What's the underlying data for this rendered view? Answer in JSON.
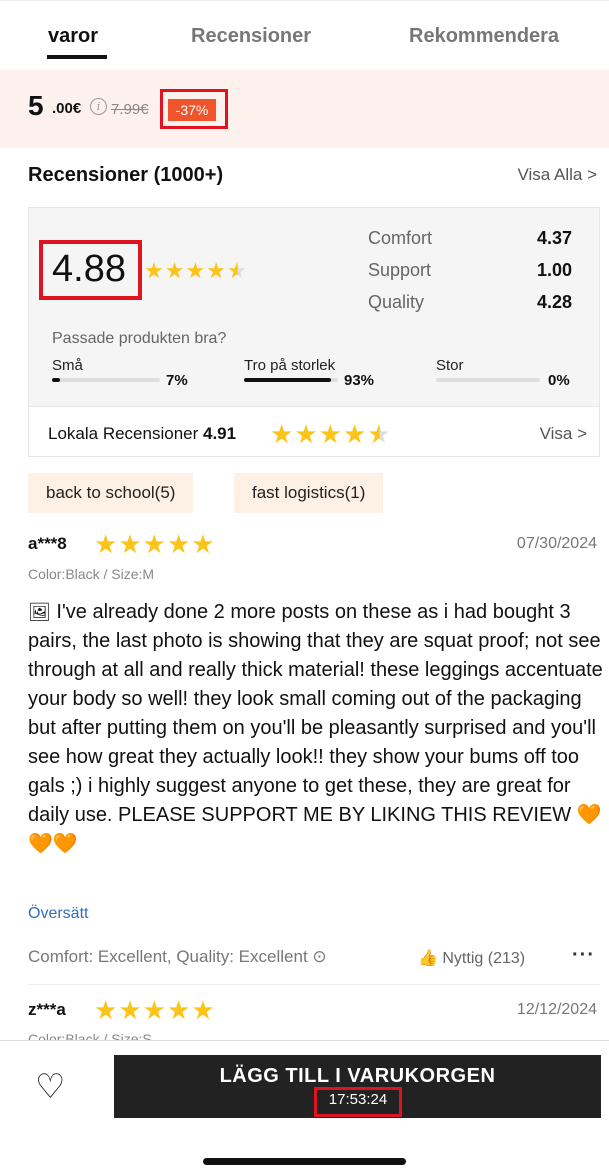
{
  "tabs": [
    {
      "label": "varor",
      "active": true
    },
    {
      "label": "Recensioner",
      "active": false
    },
    {
      "label": "Rekommendera",
      "active": false
    }
  ],
  "price": {
    "integer": "5",
    "decimal": ".00€",
    "info_icon": "info-icon",
    "original": "7.99€",
    "discount": "-37%"
  },
  "reviews_header": {
    "title": "Recensioner (1000+)",
    "see_all": "Visa Alla >"
  },
  "rating": {
    "overall": "4.88",
    "stars": 4.5,
    "dimensions": [
      {
        "label": "Comfort",
        "value": "4.37"
      },
      {
        "label": "Support",
        "value": "1.00"
      },
      {
        "label": "Quality",
        "value": "4.28"
      }
    ]
  },
  "fit": {
    "question": "Passade produkten bra?",
    "options": [
      {
        "label": "Små",
        "percent_text": "7%",
        "percent": 7
      },
      {
        "label": "Tro på storlek",
        "percent_text": "93%",
        "percent": 93
      },
      {
        "label": "Stor",
        "percent_text": "0%",
        "percent": 0
      }
    ]
  },
  "local_reviews": {
    "label": "Lokala Recensioner",
    "score": "4.91",
    "stars": 4.5,
    "action": "Visa >"
  },
  "tags": [
    "back to school(5)",
    "fast logistics(1)"
  ],
  "reviews": [
    {
      "user": "a***8",
      "stars": 5,
      "date": "07/30/2024",
      "variant": "Color:Black / Size:M",
      "text": "I've already done 2 more posts on these as i had bought 3 pairs, the last photo is showing that they are squat proof; not see through at all and really thick material! these leggings accentuate your body so well! they look small coming out of the packaging but after putting them on you'll be pleasantly surprised and you'll see how great they actually look!! they show your bums off too gals ;) i highly suggest anyone to get these, they are great for daily use.  PLEASE SUPPORT ME BY LIKING THIS REVIEW",
      "hearts": "🧡🧡🧡",
      "translate": "Översätt",
      "footer": "Comfort: Excellent, Quality: Excellent",
      "useful_label": "Nyttig",
      "useful_count": "(213)"
    },
    {
      "user": "z***a",
      "stars": 5,
      "date": "12/12/2024",
      "variant": "Color:Black / Size:S"
    }
  ],
  "bottom": {
    "cart_label": "LÄGG TILL I VARUKORGEN",
    "timer": "17:53:24"
  },
  "colors": {
    "accent_red": "#e0141e",
    "discount_bg": "#f0542d",
    "star": "#fcc419",
    "link": "#2f6fbf"
  }
}
